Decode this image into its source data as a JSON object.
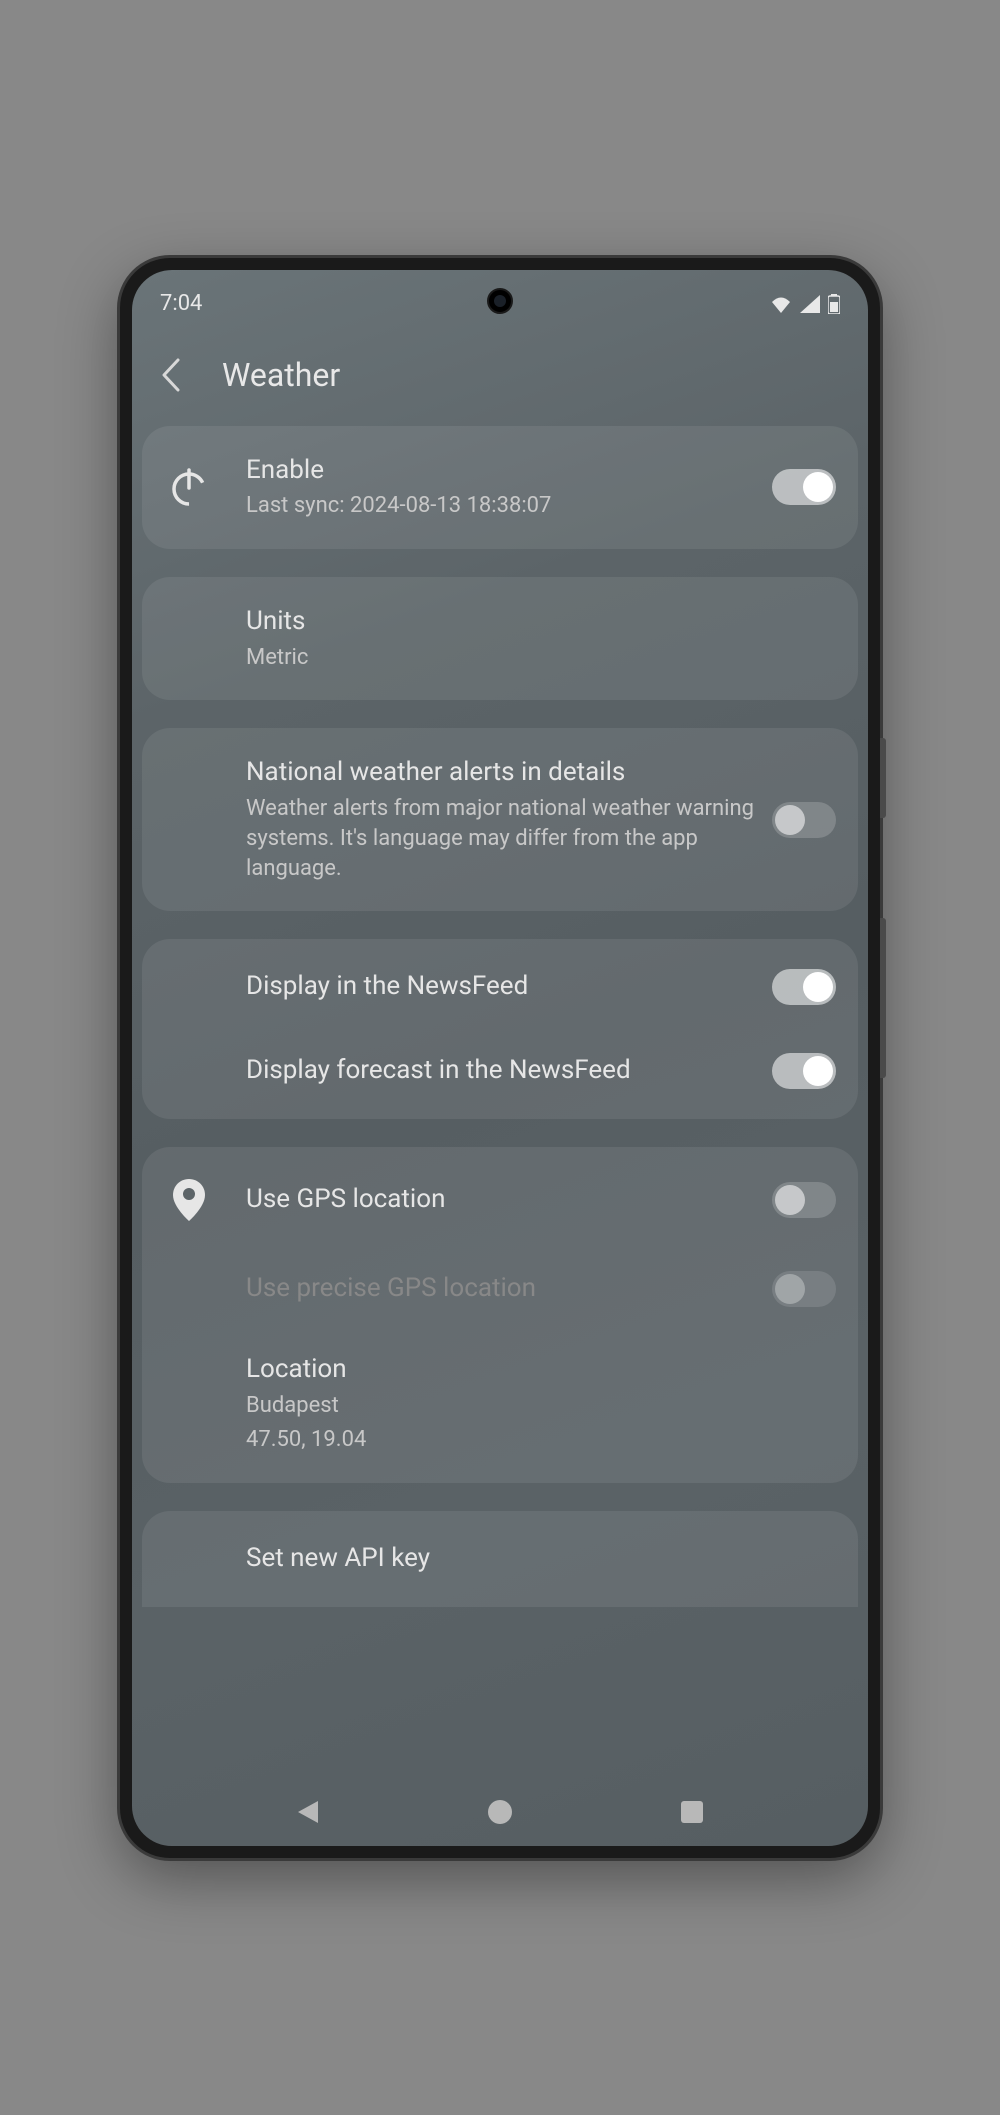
{
  "statusBar": {
    "time": "7:04"
  },
  "header": {
    "title": "Weather"
  },
  "settings": {
    "enable": {
      "title": "Enable",
      "subtitle": "Last sync: 2024-08-13 18:38:07",
      "enabled": true
    },
    "units": {
      "title": "Units",
      "value": "Metric"
    },
    "alerts": {
      "title": "National weather alerts in details",
      "subtitle": "Weather alerts from major national weather warning systems. It's language may differ from the app language.",
      "enabled": false
    },
    "displayNewsfeed": {
      "title": "Display in the NewsFeed",
      "enabled": true
    },
    "displayForecast": {
      "title": "Display forecast in the NewsFeed",
      "enabled": true
    },
    "useGps": {
      "title": "Use GPS location",
      "enabled": false
    },
    "usePreciseGps": {
      "title": "Use precise GPS location",
      "enabled": false,
      "disabled": true
    },
    "location": {
      "title": "Location",
      "city": "Budapest",
      "coords": "47.50, 19.04"
    },
    "apiKey": {
      "title": "Set new API key"
    }
  }
}
